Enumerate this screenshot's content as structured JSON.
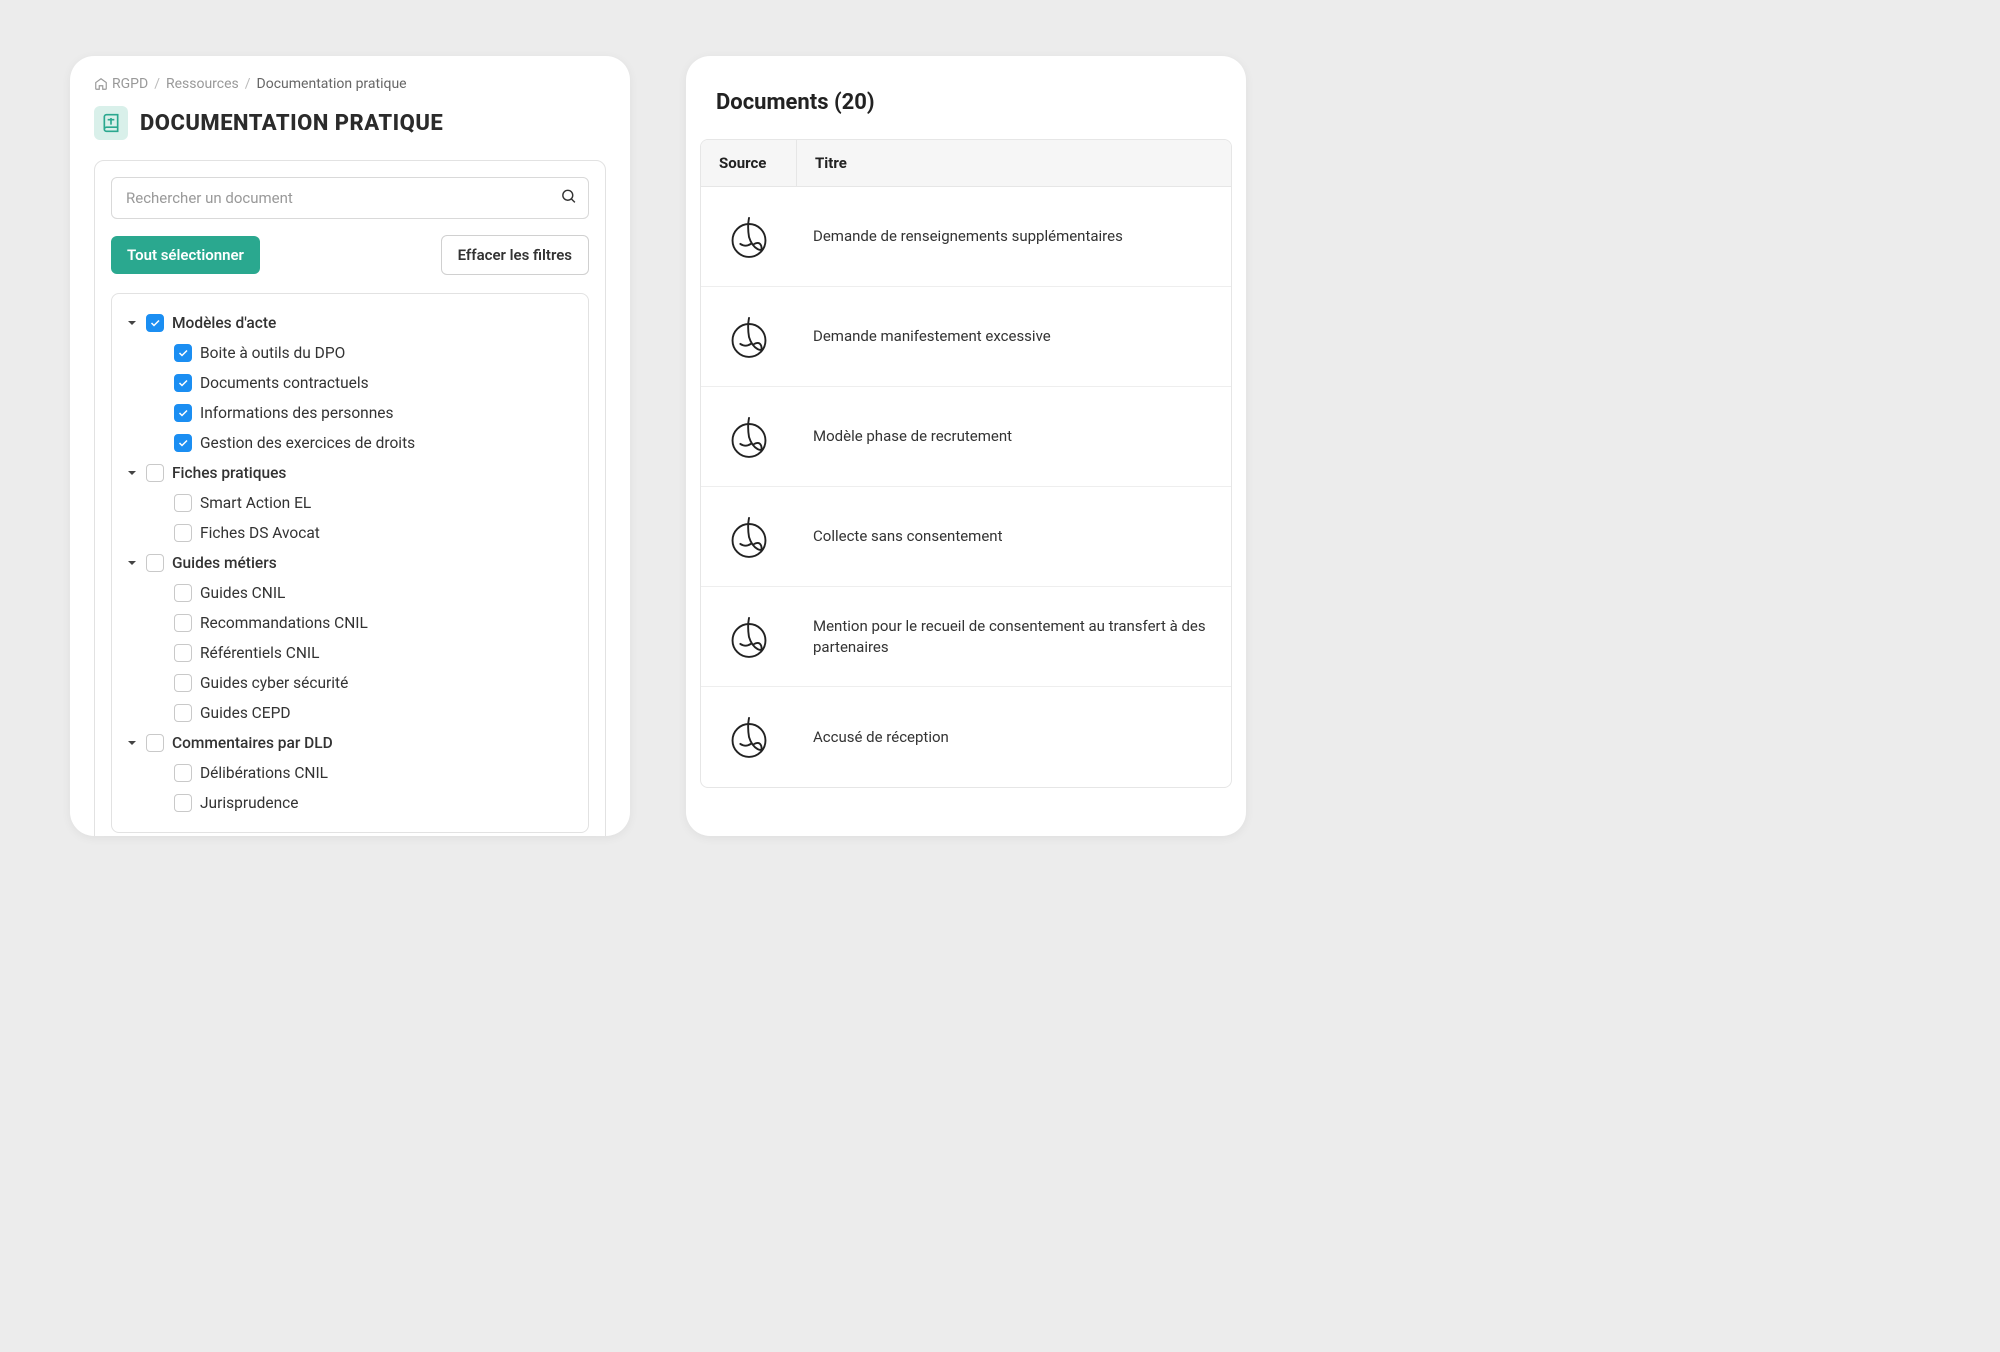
{
  "breadcrumb": {
    "root": "RGPD",
    "mid": "Ressources",
    "current": "Documentation pratique"
  },
  "page_title": "DOCUMENTATION PRATIQUE",
  "search": {
    "placeholder": "Rechercher un document"
  },
  "buttons": {
    "select_all": "Tout sélectionner",
    "clear_filters": "Effacer les filtres"
  },
  "tree": [
    {
      "label": "Modèles d'acte",
      "checked": true,
      "expanded": true,
      "children": [
        {
          "label": "Boite à outils du DPO",
          "checked": true
        },
        {
          "label": "Documents contractuels",
          "checked": true
        },
        {
          "label": "Informations des personnes",
          "checked": true
        },
        {
          "label": "Gestion des exercices de droits",
          "checked": true
        }
      ]
    },
    {
      "label": "Fiches pratiques",
      "checked": false,
      "expanded": true,
      "children": [
        {
          "label": "Smart Action EL",
          "checked": false
        },
        {
          "label": "Fiches DS Avocat",
          "checked": false
        }
      ]
    },
    {
      "label": "Guides métiers",
      "checked": false,
      "expanded": true,
      "children": [
        {
          "label": "Guides CNIL",
          "checked": false
        },
        {
          "label": "Recommandations CNIL",
          "checked": false
        },
        {
          "label": "Référentiels CNIL",
          "checked": false
        },
        {
          "label": "Guides cyber sécurité",
          "checked": false
        },
        {
          "label": "Guides CEPD",
          "checked": false
        }
      ]
    },
    {
      "label": "Commentaires par DLD",
      "checked": false,
      "expanded": true,
      "children": [
        {
          "label": "Délibérations CNIL",
          "checked": false
        },
        {
          "label": "Jurisprudence",
          "checked": false
        }
      ]
    }
  ],
  "documents": {
    "title": "Documents (20)",
    "columns": {
      "source": "Source",
      "title": "Titre"
    },
    "rows": [
      {
        "title": "Demande de renseignements supplémentaires"
      },
      {
        "title": "Demande manifestement excessive"
      },
      {
        "title": "Modèle phase de recrutement"
      },
      {
        "title": "Collecte sans consentement"
      },
      {
        "title": "Mention pour le recueil de consentement au transfert à des partenaires"
      },
      {
        "title": "Accusé de réception"
      }
    ]
  }
}
